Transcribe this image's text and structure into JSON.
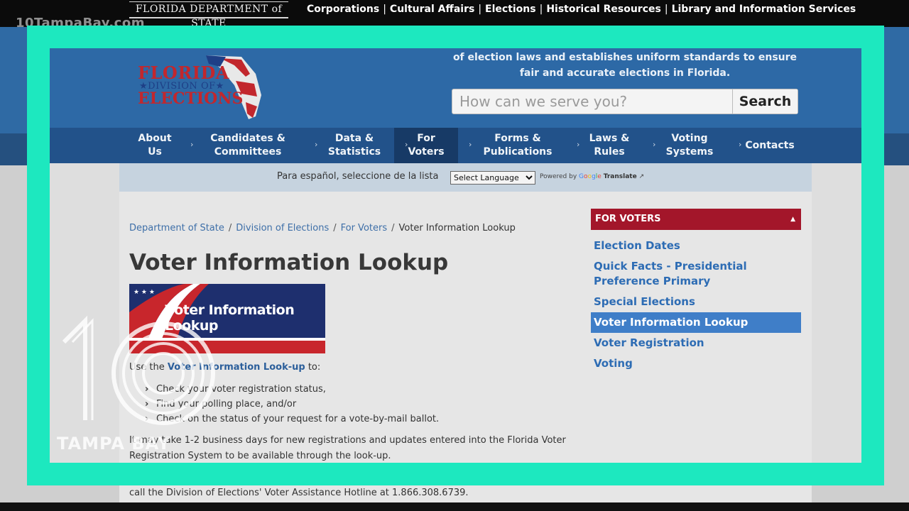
{
  "topbar": {
    "department_logo": "FLORIDA DEPARTMENT of STATE",
    "nav": [
      "Corporations",
      "Cultural Affairs",
      "Elections",
      "Historical Resources",
      "Library and Information Services"
    ],
    "watermark": "10TampaBay.com"
  },
  "header": {
    "logo_line1": "FLORIDA",
    "logo_line2": "★DIVISION OF★",
    "logo_line3": "ELECTIONS",
    "tagline": "of election laws and establishes uniform standards to ensure fair and accurate elections in Florida.",
    "search_placeholder": "How can we serve you?",
    "search_button": "Search"
  },
  "nav": {
    "items": [
      {
        "line1": "About",
        "line2": "Us"
      },
      {
        "line1": "Candidates &",
        "line2": "Committees"
      },
      {
        "line1": "Data &",
        "line2": "Statistics"
      },
      {
        "line1": "For",
        "line2": "Voters"
      },
      {
        "line1": "Forms &",
        "line2": "Publications"
      },
      {
        "line1": "Laws &",
        "line2": "Rules"
      },
      {
        "line1": "Voting",
        "line2": "Systems"
      },
      {
        "line1": "Contacts",
        "line2": ""
      }
    ],
    "active_index": 3
  },
  "translate": {
    "label": "Para español, seleccione de la lista",
    "select_value": "Select Language",
    "powered_by": "Powered by",
    "google": "Google",
    "translate_label": "Translate"
  },
  "content": {
    "breadcrumb": [
      "Department of State",
      "Division of Elections",
      "For Voters",
      "Voter Information Lookup"
    ],
    "title": "Voter Information Lookup",
    "banner_text": "Voter Information Lookup",
    "intro_prefix": "Use the ",
    "intro_link": "Voter Information Look-up",
    "intro_suffix": " to:",
    "bullets": [
      "Check your voter registration status,",
      "Find your polling place, and/or",
      "Check on the status of your request for a vote-by-mail ballot."
    ],
    "note": "It may take 1-2 business days for new registrations and updates entered into the Florida Voter Registration System to be available through the look-up.",
    "hotline_text": "call the Division of Elections' Voter Assistance Hotline at  1.866.308.6739."
  },
  "sidebar": {
    "header": "FOR VOTERS",
    "items": [
      "Election Dates",
      "Quick Facts - Presidential Preference Primary",
      "Special Elections",
      "Voter Information Lookup",
      "Voter Registration",
      "Voting"
    ],
    "active_index": 3
  },
  "station_bug": {
    "number": "10",
    "name": "TAMPA BAY"
  },
  "colors": {
    "frame": "#1de8bf",
    "header_blue": "#2d69a6",
    "nav_blue": "#22528a",
    "sidebar_red": "#a3162a",
    "link_blue": "#2d6cb4"
  }
}
